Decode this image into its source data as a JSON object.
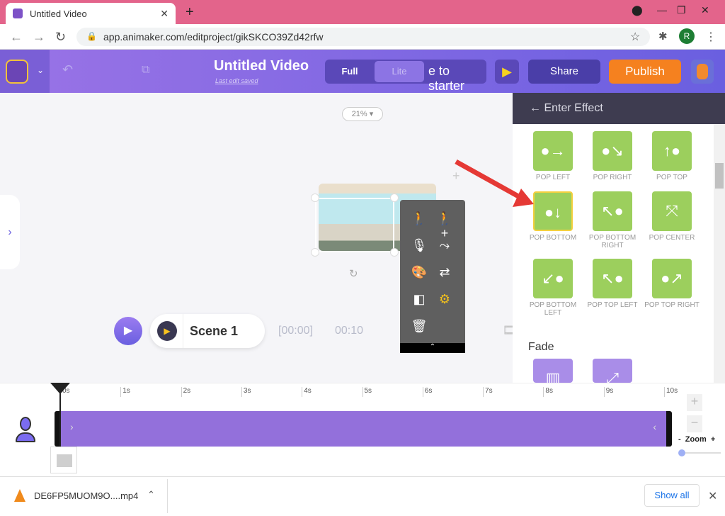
{
  "browser": {
    "tab_title": "Untitled Video",
    "url": "app.animaker.com/editproject/gikSKCO39Zd42rfw",
    "profile_initial": "R"
  },
  "header": {
    "title": "Untitled Video",
    "subtitle": "Last edit saved",
    "mode_full": "Full",
    "mode_lite": "Lite",
    "starter_partial": "e to starter",
    "share": "Share",
    "publish": "Publish"
  },
  "canvas": {
    "zoom": "21%",
    "scene_name": "Scene 1",
    "current_time": "[00:00]",
    "duration": "00:10"
  },
  "panel": {
    "title": "Enter Effect",
    "effects": [
      {
        "label": "POP LEFT",
        "icon": "●→"
      },
      {
        "label": "POP RIGHT",
        "icon": "●↘"
      },
      {
        "label": "POP TOP",
        "icon": "↑●"
      },
      {
        "label": "POP BOTTOM",
        "icon": "●↓",
        "selected": true
      },
      {
        "label": "POP BOTTOM RIGHT",
        "icon": "↖●"
      },
      {
        "label": "POP CENTER",
        "icon": "⤧"
      },
      {
        "label": "POP BOTTOM LEFT",
        "icon": "↙●"
      },
      {
        "label": "POP TOP LEFT",
        "icon": "↖●"
      },
      {
        "label": "POP TOP RIGHT",
        "icon": "●↗"
      }
    ],
    "section_fade": "Fade"
  },
  "timeline": {
    "ticks": [
      "0s",
      "1s",
      "2s",
      "3s",
      "4s",
      "5s",
      "6s",
      "7s",
      "8s",
      "9s",
      "10s"
    ],
    "zoom_label": "Zoom",
    "zoom_minus": "-",
    "zoom_plus": "+"
  },
  "download": {
    "filename": "DE6FP5MUOM9O....mp4",
    "show_all": "Show all"
  },
  "colors": {
    "accent": "#9370db",
    "publish": "#f5811f",
    "effect_tile": "#9ccf5d"
  }
}
